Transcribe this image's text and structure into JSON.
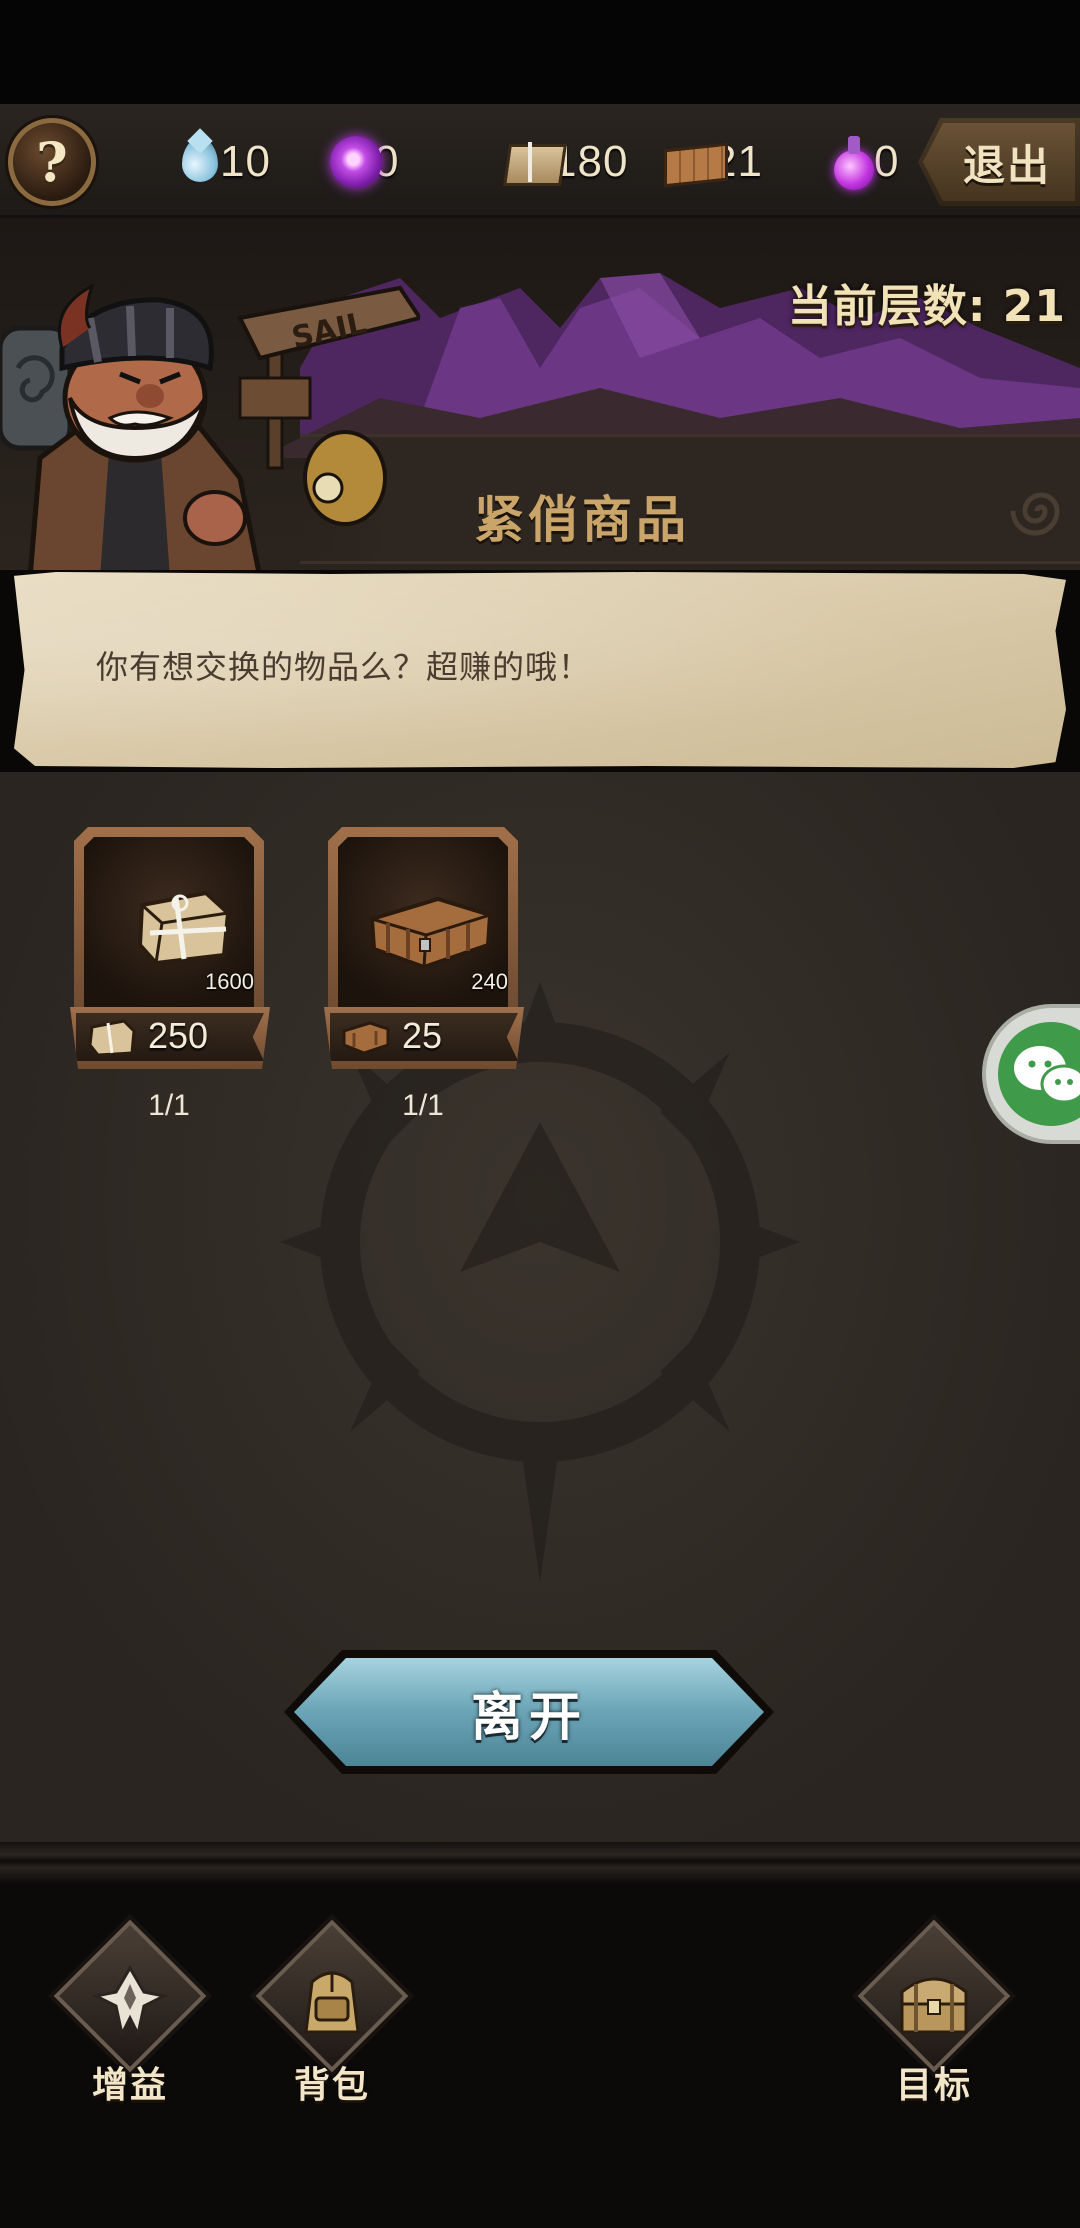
{
  "resources": [
    {
      "name": "water-drop",
      "value": "10"
    },
    {
      "name": "purple-orb",
      "value": "0"
    },
    {
      "name": "parcel",
      "value": "180"
    },
    {
      "name": "crate",
      "value": "21"
    },
    {
      "name": "potion",
      "value": "0"
    }
  ],
  "header": {
    "help_label": "?",
    "exit_label": "退出",
    "level_text": "当前层数: 21",
    "sign_text": "SAIL"
  },
  "shop": {
    "title": "紧俏商品",
    "dialog": "你有想交换的物品么？超赚的哦！",
    "items": [
      {
        "quantity": "1600",
        "price": "250",
        "limit": "1/1",
        "icon": "parcel"
      },
      {
        "quantity": "240",
        "price": "25",
        "limit": "1/1",
        "icon": "crate"
      }
    ],
    "leave_label": "离开"
  },
  "nav": [
    {
      "label": "增益",
      "icon": "buff-icon"
    },
    {
      "label": "背包",
      "icon": "backpack-icon"
    },
    {
      "label": "目标",
      "icon": "treasure-chest-icon"
    }
  ],
  "colors": {
    "accent_title": "#c9a56a",
    "parchment": "#e9ddc3",
    "leave_button": "#6aa4b6",
    "mountain_purple": "#5a2d6e"
  }
}
